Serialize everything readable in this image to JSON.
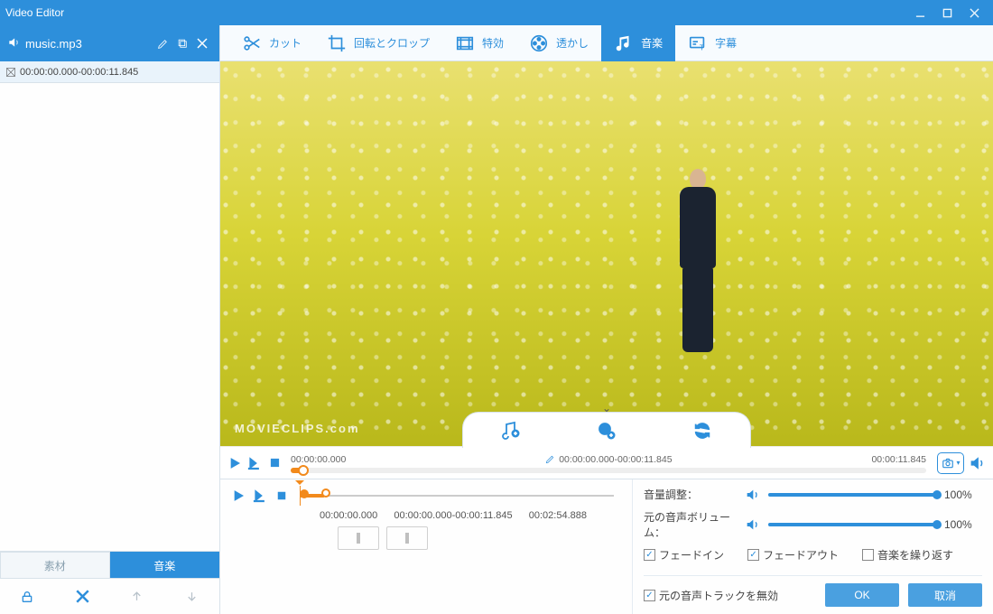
{
  "window": {
    "title": "Video Editor"
  },
  "sidebar": {
    "file_name": "music.mp3",
    "clip_range": "00:00:00.000-00:00:11.845",
    "tabs": {
      "material": "素材",
      "music": "音楽"
    }
  },
  "toolbar": {
    "cut": "カット",
    "rotate_crop": "回転とクロップ",
    "effects": "特効",
    "watermark": "透かし",
    "music": "音楽",
    "subtitles": "字幕"
  },
  "preview": {
    "watermark_text": "MOVIECLIPS.com"
  },
  "transport": {
    "start_time": "00:00:00.000",
    "range": "00:00:00.000-00:00:11.845",
    "end_time": "00:00:11.845",
    "progress_pct": 2
  },
  "timeline": {
    "start": "00:00:00.000",
    "range": "00:00:00.000-00:00:11.845",
    "total": "00:02:54.888"
  },
  "settings": {
    "volume_label": "音量調整：",
    "original_volume_label": "元の音声ボリューム：",
    "volume_pct": "100%",
    "original_pct": "100%",
    "fade_in": "フェードイン",
    "fade_out": "フェードアウト",
    "repeat": "音楽を繰り返す",
    "mute_original": "元の音声トラックを無効",
    "ok": "OK",
    "cancel": "取消"
  }
}
